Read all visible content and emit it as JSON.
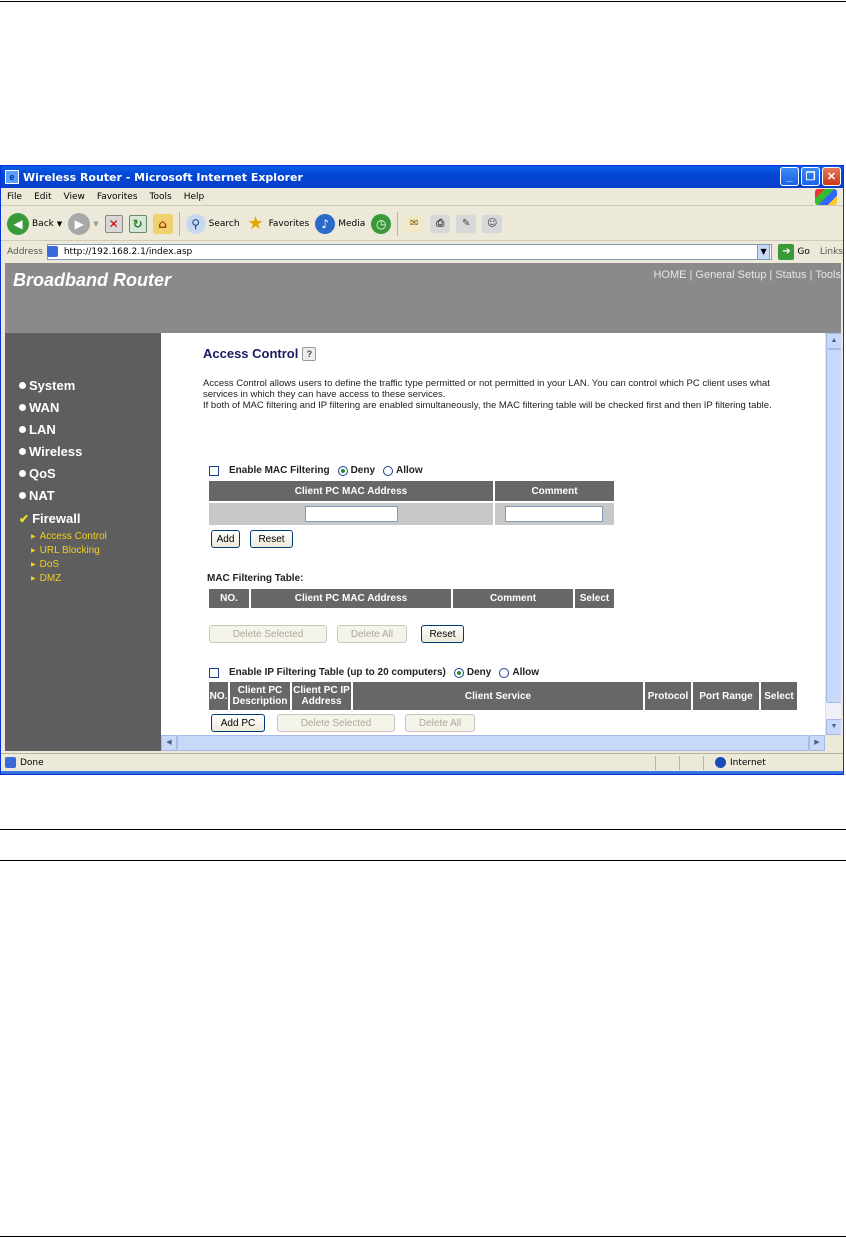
{
  "window": {
    "title": "Wireless Router - Microsoft Internet Explorer",
    "controls": [
      "_",
      "❐",
      "✕"
    ]
  },
  "menu": [
    "File",
    "Edit",
    "View",
    "Favorites",
    "Tools",
    "Help"
  ],
  "toolbar": {
    "back": "Back",
    "search": "Search",
    "favorites": "Favorites",
    "media": "Media"
  },
  "address": {
    "label": "Address",
    "url": "http://192.168.2.1/index.asp",
    "go": "Go",
    "links": "Links"
  },
  "header": {
    "brand": "Broadband Router",
    "nav": [
      "HOME",
      "General Setup",
      "Status",
      "Tools"
    ],
    "separator": "|"
  },
  "sidebar": {
    "items": [
      "System",
      "WAN",
      "LAN",
      "Wireless",
      "QoS",
      "NAT",
      "Firewall"
    ],
    "sub_items": [
      "Access Control",
      "URL Blocking",
      "DoS",
      "DMZ"
    ]
  },
  "content": {
    "title": "Access Control",
    "description_1": "Access Control allows users to define the traffic type permitted or not permitted in your LAN. You can control which PC client uses what services in which they can have access to these services.",
    "description_2": "If both of MAC filtering and IP filtering are enabled simultaneously, the MAC filtering table will be checked first and then IP filtering table.",
    "mac_filter": {
      "enable_label": "Enable MAC Filtering",
      "deny": "Deny",
      "allow": "Allow",
      "col_mac": "Client PC MAC Address",
      "col_comment": "Comment",
      "add": "Add",
      "reset": "Reset"
    },
    "mac_table": {
      "heading": "MAC Filtering Table:",
      "columns": [
        "NO.",
        "Client PC MAC Address",
        "Comment",
        "Select"
      ],
      "delete_selected": "Delete Selected",
      "delete_all": "Delete All",
      "reset": "Reset"
    },
    "ip_filter": {
      "enable_label": "Enable IP Filtering Table (up to 20 computers)",
      "deny": "Deny",
      "allow": "Allow",
      "columns": [
        "NO.",
        "Client PC Description",
        "Client PC IP Address",
        "Client Service",
        "Protocol",
        "Port Range",
        "Select"
      ],
      "add_pc": "Add PC",
      "delete_selected": "Delete Selected",
      "delete_all": "Delete All"
    }
  },
  "status": {
    "text": "Done",
    "zone": "Internet"
  }
}
